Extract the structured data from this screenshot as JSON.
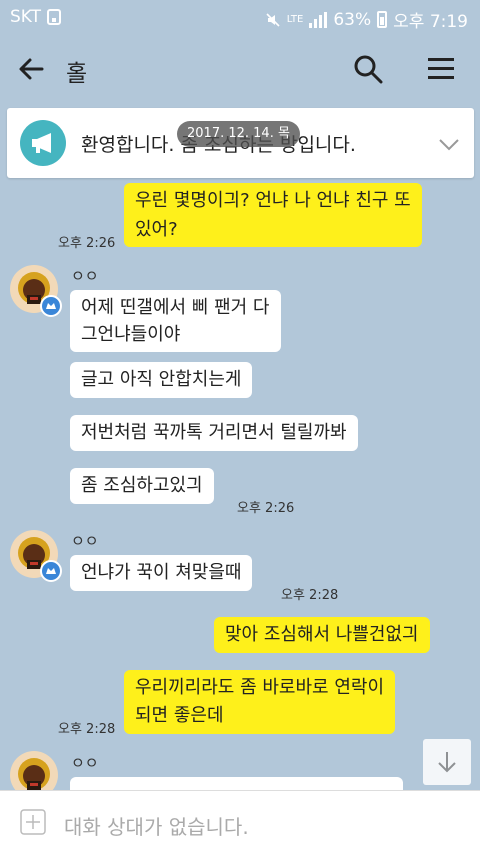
{
  "status": {
    "carrier": "SKT",
    "network": "LTE",
    "battery": "63%",
    "time": "오후 7:19"
  },
  "header": {
    "title": "홀",
    "back_icon": "back-arrow-icon",
    "search_icon": "search-icon",
    "menu_icon": "menu-icon"
  },
  "notice": {
    "text": "환영합니다. 좀 조심하는 방입니다.",
    "icon": "megaphone-icon"
  },
  "date_pill": "2017. 12. 14. 목",
  "messages": {
    "m1": {
      "text": "우린 몇명이긔? 언냐 나 언냐 친구 또\n있어?",
      "time": "오후 2:26"
    },
    "g1": {
      "sender": "ㅇㅇ",
      "b1": "어제 띤갤에서 삐 팬거 다\n그언냐들이야",
      "b2": "글고 아직 안합치는게",
      "b3": "저번처럼 꾹까톡 거리면서 털릴까봐",
      "b4": "좀 조심하고있긔",
      "time": "오후 2:26"
    },
    "g2": {
      "sender": "ㅇㅇ",
      "b1": "언냐가 꾹이 쳐맞을때",
      "time": "오후 2:28"
    },
    "m2": {
      "text": "맞아 조심해서 나쁠건없긔"
    },
    "m3": {
      "text": "우리끼리라도 좀 바로바로 연락이\n되면 좋은데",
      "time": "오후 2:28"
    },
    "g3": {
      "sender": "ㅇㅇ"
    }
  },
  "input": {
    "placeholder": "대화 상대가 없습니다."
  },
  "colors": {
    "background": "#b2c7d9",
    "my_bubble": "#fef01b",
    "other_bubble": "#ffffff",
    "notice_icon": "#45b5c0"
  }
}
